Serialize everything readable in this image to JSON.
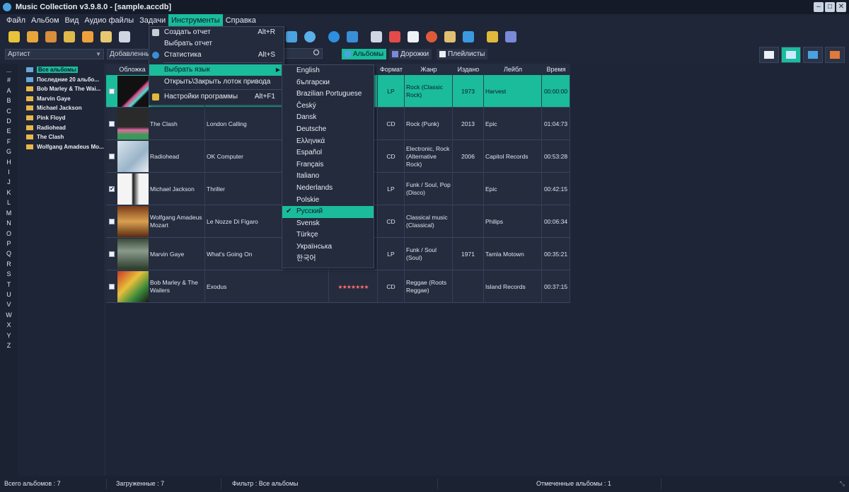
{
  "window": {
    "title": "Music Collection v3.9.8.0 - [sample.accdb]",
    "controls": [
      "–",
      "□",
      "✕"
    ]
  },
  "menubar": [
    "Файл",
    "Альбом",
    "Вид",
    "Аудио файлы",
    "Задачи",
    "Инструменты",
    "Справка"
  ],
  "filter": {
    "artist_select": "Артист",
    "sort_select": "Добавленные"
  },
  "segments": [
    "Альбомы",
    "Дорожки",
    "Плейлисты"
  ],
  "alphabet": [
    "...",
    "#",
    "A",
    "B",
    "C",
    "D",
    "E",
    "F",
    "G",
    "H",
    "I",
    "J",
    "K",
    "L",
    "M",
    "N",
    "O",
    "P",
    "Q",
    "R",
    "S",
    "T",
    "U",
    "V",
    "W",
    "X",
    "Y",
    "Z"
  ],
  "tree": [
    "Все альбомы",
    "Последние 20 альбо...",
    "Bob Marley & The Wai...",
    "Marvin Gaye",
    "Michael Jackson",
    "Pink Floyd",
    "Radiohead",
    "The Clash",
    "Wolfgang Amadeus Mo..."
  ],
  "table": {
    "headers": {
      "cover": "Обложка",
      "format": "Формат",
      "genre": "Жанр",
      "year": "Издано",
      "label": "Лейбл",
      "time": "Время"
    },
    "rows": [
      {
        "checked": "",
        "artist": "",
        "album": "",
        "rating": "",
        "format": "LP",
        "genre": "Rock (Classic Rock)",
        "year": "1973",
        "label": "Harvest",
        "time": "00:00:00"
      },
      {
        "checked": "",
        "artist": "The Clash",
        "album": "London Calling",
        "rating": "",
        "format": "CD",
        "genre": "Rock (Punk)",
        "year": "2013",
        "label": "Epic",
        "time": "01:04:73"
      },
      {
        "checked": "",
        "artist": "Radiohead",
        "album": "OK Computer",
        "rating": "",
        "format": "CD",
        "genre": "Electronic, Rock (Alternative Rock)",
        "year": "2006",
        "label": "Capitol Records",
        "time": "00:53:28"
      },
      {
        "checked": "✔",
        "artist": "Michael Jackson",
        "album": "Thriller",
        "rating": "",
        "format": "LP",
        "genre": "Funk / Soul, Pop (Disco)",
        "year": "",
        "label": "Epic",
        "time": "00:42:15"
      },
      {
        "checked": "",
        "artist": "Wolfgang Amadeus Mozart",
        "album": "Le Nozze Di Figaro",
        "rating": "",
        "format": "CD",
        "genre": "Classical music (Classical)",
        "year": "",
        "label": "Philips",
        "time": "00:06:34"
      },
      {
        "checked": "",
        "artist": "Marvin Gaye",
        "album": "What's Going On",
        "rating": "",
        "format": "LP",
        "genre": "Funk / Soul (Soul)",
        "year": "1971",
        "label": "Tamla Motown",
        "time": "00:35:21"
      },
      {
        "checked": "",
        "artist": "Bob Marley & The Wailers",
        "album": "Exodus",
        "rating": "★★★★★★★",
        "format": "CD",
        "genre": "Reggae (Roots Reggae)",
        "year": "",
        "label": "Island Records",
        "time": "00:37:15"
      }
    ]
  },
  "tools_menu": [
    {
      "label": "Создать отчет",
      "shortcut": "Alt+R"
    },
    {
      "label": "Выбрать отчет",
      "shortcut": ""
    },
    {
      "label": "Статистика",
      "shortcut": "Alt+S"
    },
    {
      "label": "Выбрать язык",
      "shortcut": ""
    },
    {
      "label": "Открыть\\Закрыть лоток привода",
      "shortcut": ""
    },
    {
      "label": "Настройки программы",
      "shortcut": "Alt+F1"
    }
  ],
  "languages": [
    "English",
    "български",
    "Brazilian Portuguese",
    "Český",
    "Dansk",
    "Deutsche",
    "Ελληνικά",
    "Español",
    "Français",
    "Italiano",
    "Nederlands",
    "Polskie",
    "Русский",
    "Svensk",
    "Türkçe",
    "Українська",
    "한국어"
  ],
  "selected_language": "Русский",
  "status": {
    "total": "Всего альбомов : 7",
    "loaded": "Загруженные : 7",
    "filter": "Фильтр : Все альбомы",
    "checked": "Отмеченные альбомы : 1"
  },
  "colors": {
    "accent": "#1abc9c",
    "background": "#1e2536",
    "row": "#242c3e"
  }
}
